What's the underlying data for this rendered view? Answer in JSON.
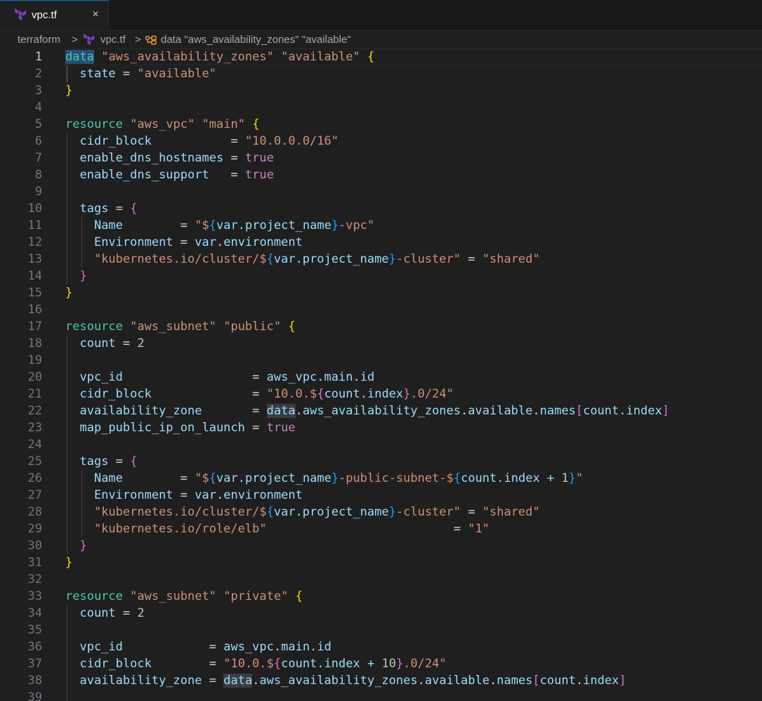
{
  "tab": {
    "label": "vpc.tf",
    "close_glyph": "×",
    "icon": "terraform-icon"
  },
  "breadcrumb": {
    "folder": "terraform",
    "file": "vpc.tf",
    "symbol": "data \"aws_availability_zones\" \"available\"",
    "separator": ">"
  },
  "colors": {
    "keyword": "#4ec9b0",
    "string": "#ce9178",
    "boolean": "#c586c0",
    "number": "#b5cea8",
    "identifier": "#9cdcfe",
    "bracket_level1": "#ffd700",
    "bracket_level2": "#da70d6",
    "bracket_level3": "#179fff",
    "terraform_purple": "#7b42bc"
  },
  "editor": {
    "active_line": 1,
    "lines": [
      {
        "n": "1",
        "code": "data \"aws_availability_zones\" \"available\" {"
      },
      {
        "n": "2",
        "code": "  state = \"available\""
      },
      {
        "n": "3",
        "code": "}"
      },
      {
        "n": "4",
        "code": ""
      },
      {
        "n": "5",
        "code": "resource \"aws_vpc\" \"main\" {"
      },
      {
        "n": "6",
        "code": "  cidr_block           = \"10.0.0.0/16\""
      },
      {
        "n": "7",
        "code": "  enable_dns_hostnames = true"
      },
      {
        "n": "8",
        "code": "  enable_dns_support   = true"
      },
      {
        "n": "9",
        "code": ""
      },
      {
        "n": "10",
        "code": "  tags = {"
      },
      {
        "n": "11",
        "code": "    Name        = \"${var.project_name}-vpc\""
      },
      {
        "n": "12",
        "code": "    Environment = var.environment"
      },
      {
        "n": "13",
        "code": "    \"kubernetes.io/cluster/${var.project_name}-cluster\" = \"shared\""
      },
      {
        "n": "14",
        "code": "  }"
      },
      {
        "n": "15",
        "code": "}"
      },
      {
        "n": "16",
        "code": ""
      },
      {
        "n": "17",
        "code": "resource \"aws_subnet\" \"public\" {"
      },
      {
        "n": "18",
        "code": "  count = 2"
      },
      {
        "n": "19",
        "code": ""
      },
      {
        "n": "20",
        "code": "  vpc_id                  = aws_vpc.main.id"
      },
      {
        "n": "21",
        "code": "  cidr_block              = \"10.0.${count.index}.0/24\""
      },
      {
        "n": "22",
        "code": "  availability_zone       = data.aws_availability_zones.available.names[count.index]"
      },
      {
        "n": "23",
        "code": "  map_public_ip_on_launch = true"
      },
      {
        "n": "24",
        "code": ""
      },
      {
        "n": "25",
        "code": "  tags = {"
      },
      {
        "n": "26",
        "code": "    Name        = \"${var.project_name}-public-subnet-${count.index + 1}\""
      },
      {
        "n": "27",
        "code": "    Environment = var.environment"
      },
      {
        "n": "28",
        "code": "    \"kubernetes.io/cluster/${var.project_name}-cluster\" = \"shared\""
      },
      {
        "n": "29",
        "code": "    \"kubernetes.io/role/elb\"                          = \"1\""
      },
      {
        "n": "30",
        "code": "  }"
      },
      {
        "n": "31",
        "code": "}"
      },
      {
        "n": "32",
        "code": ""
      },
      {
        "n": "33",
        "code": "resource \"aws_subnet\" \"private\" {"
      },
      {
        "n": "34",
        "code": "  count = 2"
      },
      {
        "n": "35",
        "code": ""
      },
      {
        "n": "36",
        "code": "  vpc_id            = aws_vpc.main.id"
      },
      {
        "n": "37",
        "code": "  cidr_block        = \"10.0.${count.index + 10}.0/24\""
      },
      {
        "n": "38",
        "code": "  availability_zone = data.aws_availability_zones.available.names[count.index]"
      },
      {
        "n": "39",
        "code": ""
      }
    ]
  }
}
